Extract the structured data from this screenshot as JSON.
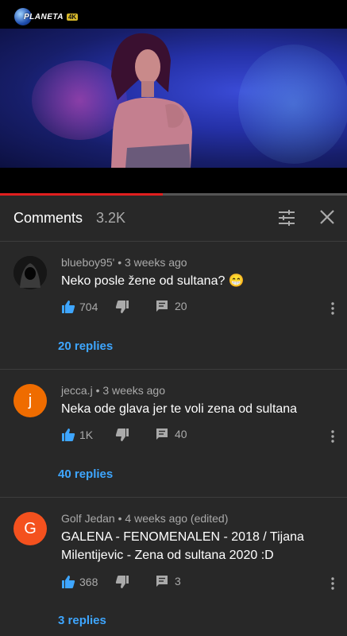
{
  "video": {
    "logo_text": "PLANETA",
    "logo_badge": "4K",
    "progress_percent": 47
  },
  "header": {
    "title": "Comments",
    "count": "3.2K"
  },
  "comments": [
    {
      "author": "blueboy95'",
      "time": "3 weeks ago",
      "text": "Neko posle žene od sultana? 😁",
      "likes": "704",
      "reply_count": "20",
      "replies_label": "20 replies",
      "avatar_letter": "",
      "avatar_color": "#1a1a1a"
    },
    {
      "author": "jecca.j",
      "time": "3 weeks ago",
      "text": "Neka ode glava jer te voli zena od sultana",
      "likes": "1K",
      "reply_count": "40",
      "replies_label": "40 replies",
      "avatar_letter": "j",
      "avatar_color": "#ef6c00"
    },
    {
      "author": "Golf Jedan",
      "time": "4 weeks ago (edited)",
      "text": "GALENA - FENOMENALEN - 2018 / Tijana Milentijevic - Zena  od sultana 2020 :D",
      "likes": "368",
      "reply_count": "3",
      "replies_label": "3 replies",
      "avatar_letter": "G",
      "avatar_color": "#f4511e"
    }
  ],
  "colors": {
    "accent": "#3ea6ff",
    "like_active": "#3ea6ff",
    "progress": "#e01f1f",
    "background": "#282828"
  },
  "icons": [
    "sort-icon",
    "close-icon",
    "thumbs-up-icon",
    "thumbs-down-icon",
    "reply-icon",
    "more-vert-icon"
  ]
}
